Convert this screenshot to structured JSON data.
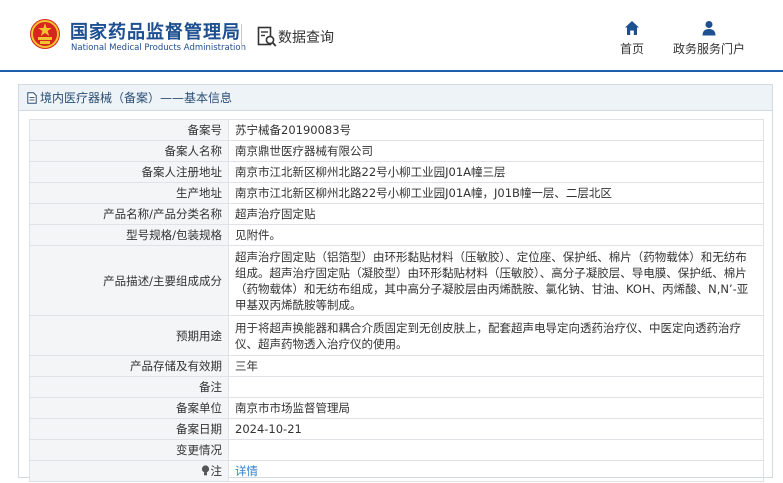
{
  "header": {
    "logo_cn": "国家药品监督管理局",
    "logo_en": "National Medical Products Administration",
    "search_label": "数据查询",
    "nav": [
      {
        "label": "首页",
        "icon": "home-icon"
      },
      {
        "label": "政务服务门户",
        "icon": "user-icon"
      }
    ]
  },
  "panel": {
    "title": "境内医疗器械（备案）——基本信息",
    "rows": [
      {
        "key": "备案号",
        "value": "苏宁械备20190083号"
      },
      {
        "key": "备案人名称",
        "value": "南京鼎世医疗器械有限公司"
      },
      {
        "key": "备案人注册地址",
        "value": "南京市江北新区柳州北路22号小柳工业园J01A幢三层"
      },
      {
        "key": "生产地址",
        "value": "南京市江北新区柳州北路22号小柳工业园J01A幢，J01B幢一层、二层北区"
      },
      {
        "key": "产品名称/产品分类名称",
        "value": "超声治疗固定贴"
      },
      {
        "key": "型号规格/包装规格",
        "value": "见附件。"
      },
      {
        "key": "产品描述/主要组成成分",
        "value": "超声治疗固定贴（铝箔型）由环形黏贴材料（压敏胶）、定位座、保护纸、棉片（药物载体）和无纺布组成。超声治疗固定贴（凝胶型）由环形黏贴材料（压敏胶）、高分子凝胶层、导电膜、保护纸、棉片（药物载体）和无纺布组成，其中高分子凝胶层由丙烯酰胺、氯化钠、甘油、KOH、丙烯酸、N,N’-亚甲基双丙烯酰胺等制成。"
      },
      {
        "key": "预期用途",
        "value": "用于将超声换能器和耦合介质固定到无创皮肤上，配套超声电导定向透药治疗仪、中医定向透药治疗仪、超声药物透入治疗仪的使用。"
      },
      {
        "key": "产品存储及有效期",
        "value": "三年"
      },
      {
        "key": "备注",
        "value": ""
      },
      {
        "key": "备案单位",
        "value": "南京市市场监督管理局"
      },
      {
        "key": "备案日期",
        "value": "2024-10-21"
      },
      {
        "key": "变更情况",
        "value": ""
      },
      {
        "key": "注",
        "value": "详情"
      }
    ]
  },
  "colors": {
    "brand_blue": "#1d4f91",
    "link_blue": "#2d7fd2",
    "emblem_red": "#d7261e",
    "emblem_gold": "#f2c230"
  }
}
